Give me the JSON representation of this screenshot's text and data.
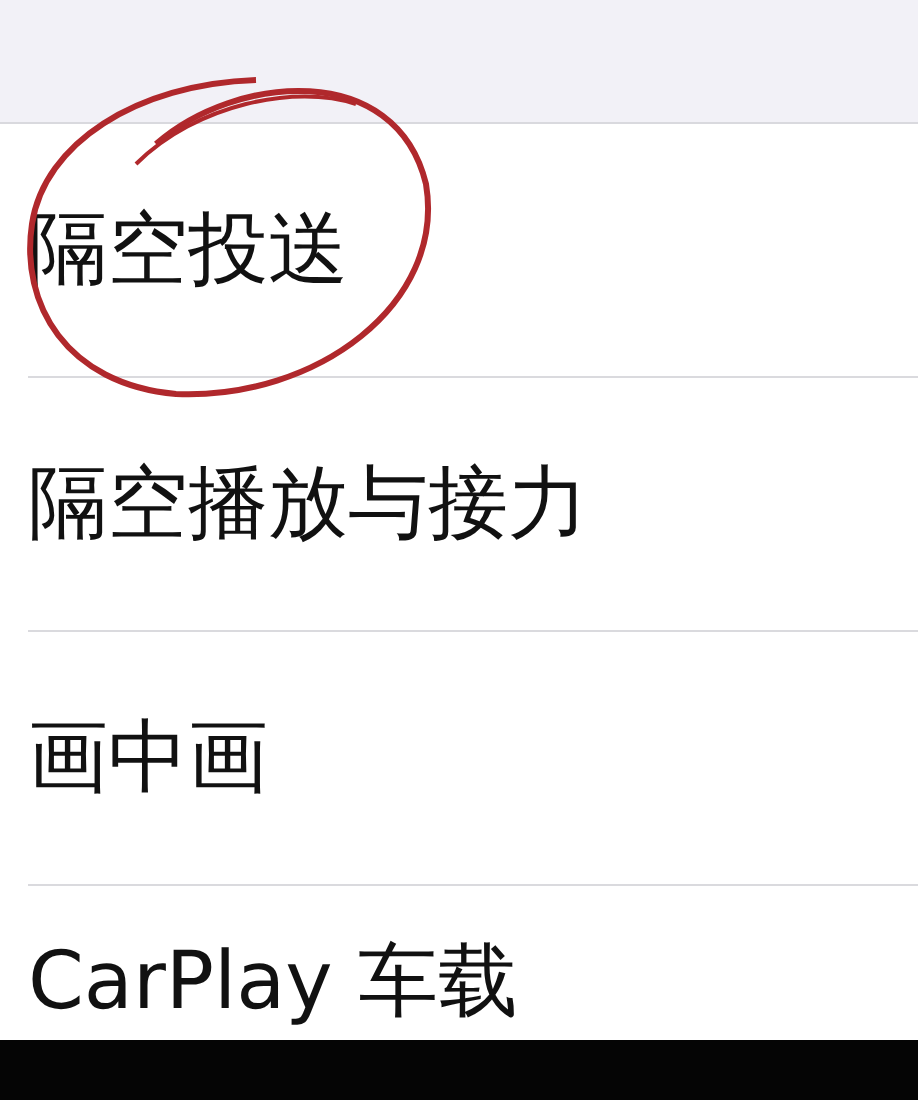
{
  "settings_list": [
    {
      "label": "隔空投送",
      "circled": true
    },
    {
      "label": "隔空播放与接力",
      "circled": false
    },
    {
      "label": "画中画",
      "circled": false
    },
    {
      "label": "CarPlay 车载",
      "circled": false
    }
  ]
}
